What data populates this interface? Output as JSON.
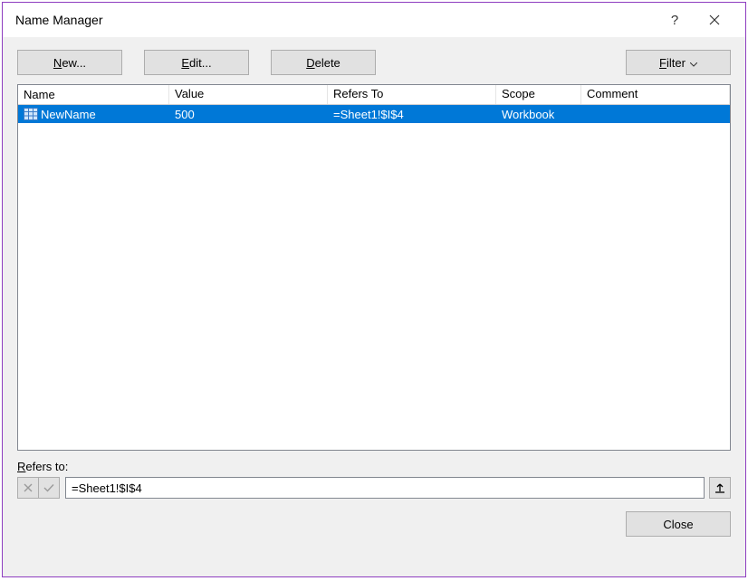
{
  "title": "Name Manager",
  "toolbar": {
    "new_label": "New...",
    "edit_label": "Edit...",
    "delete_label": "Delete",
    "filter_label": "Filter"
  },
  "columns": {
    "name": "Name",
    "value": "Value",
    "refers_to": "Refers To",
    "scope": "Scope",
    "comment": "Comment"
  },
  "rows": [
    {
      "name": "NewName",
      "value": "500",
      "refers_to": "=Sheet1!$I$4",
      "scope": "Workbook",
      "comment": ""
    }
  ],
  "refers_to_label": "Refers to:",
  "refers_to_value": "=Sheet1!$I$4",
  "close_label": "Close"
}
